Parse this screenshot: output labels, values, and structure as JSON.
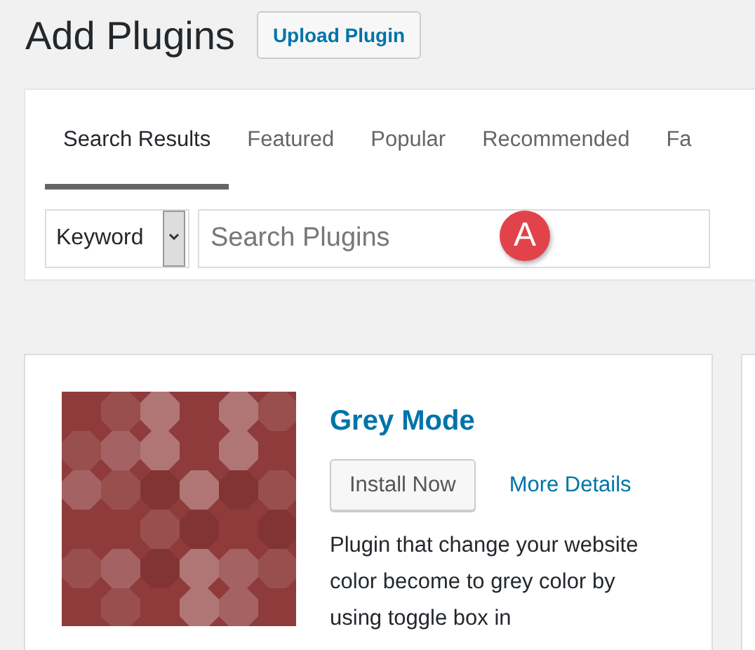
{
  "page_title": "Add Plugins",
  "upload_button": "Upload Plugin",
  "tabs": [
    {
      "label": "Search Results",
      "selected": true
    },
    {
      "label": "Featured",
      "selected": false
    },
    {
      "label": "Popular",
      "selected": false
    },
    {
      "label": "Recommended",
      "selected": false
    },
    {
      "label": "Fa",
      "selected": false
    }
  ],
  "search": {
    "type_select": "Keyword",
    "placeholder": "Search Plugins",
    "annotation": "A"
  },
  "plugins": [
    {
      "name": "Grey Mode",
      "install_button": "Install Now",
      "details_link": "More Details",
      "description": "Plugin that change your website color become to grey color by using toggle box in"
    }
  ]
}
